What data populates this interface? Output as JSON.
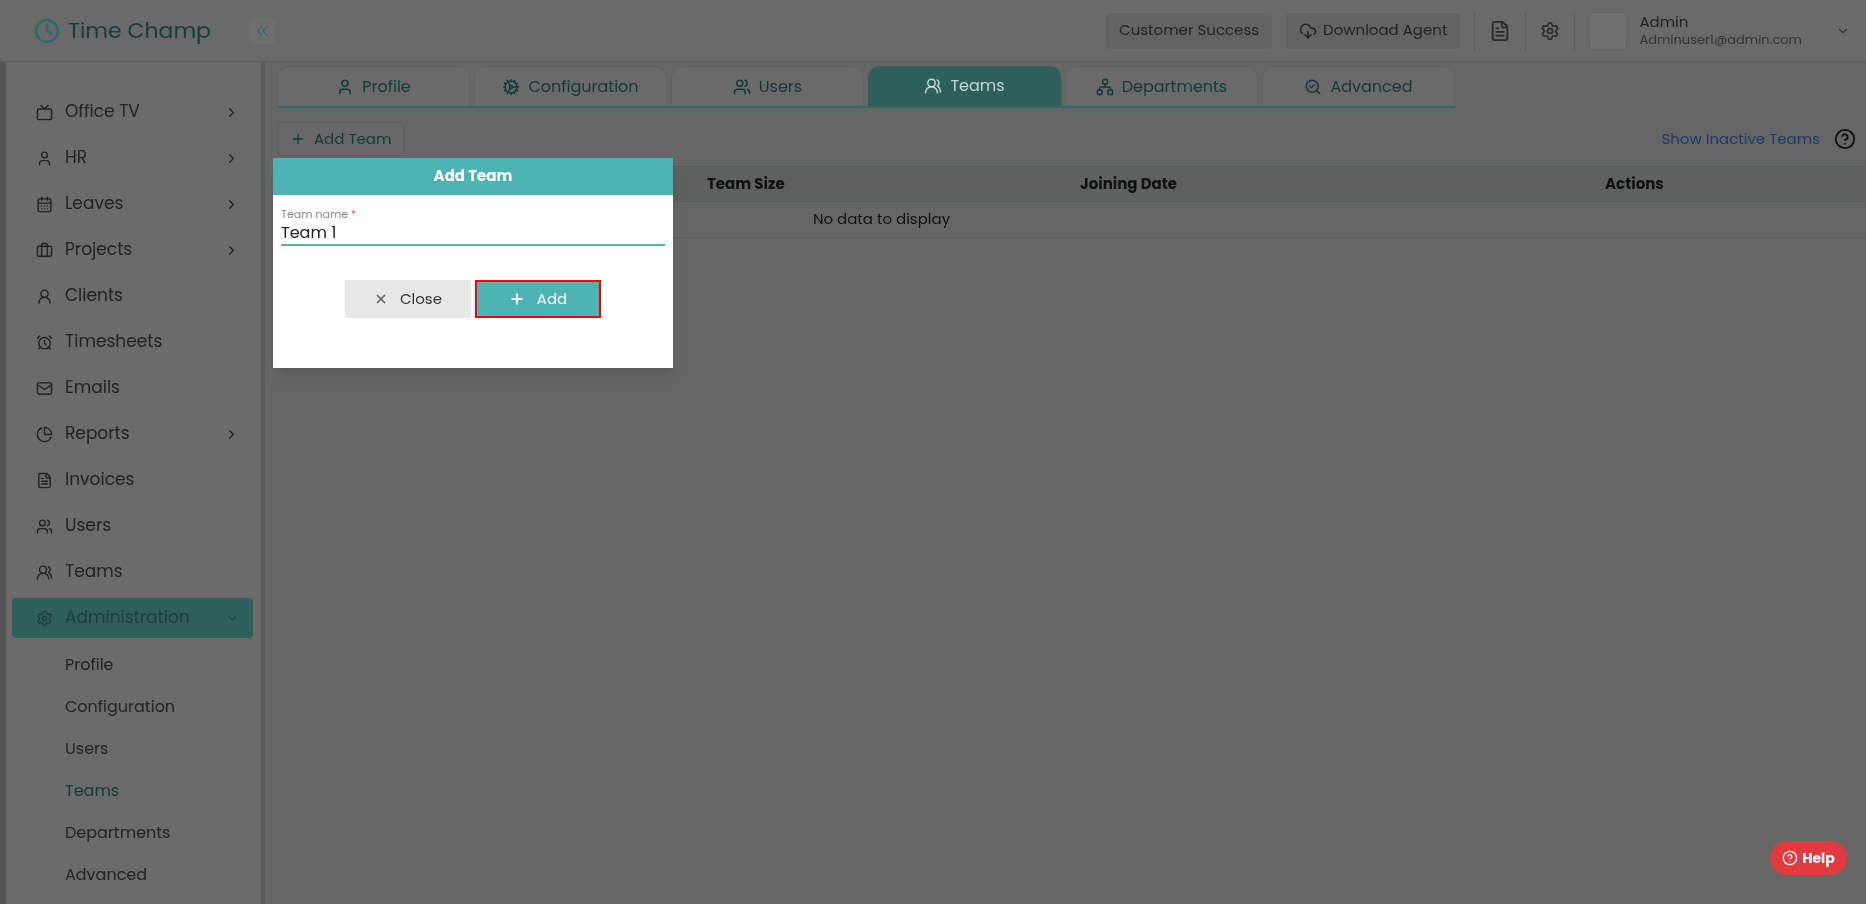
{
  "brand": {
    "name": "Time Champ"
  },
  "topbar": {
    "buttons": [
      "Customer Success",
      "Download Agent"
    ],
    "user": {
      "name": "Admin",
      "email": "Adminuser1@admin.com"
    }
  },
  "sidebar": {
    "items": [
      {
        "label": "Office TV",
        "submenu": true,
        "expanded": false,
        "selected": false
      },
      {
        "label": "HR",
        "submenu": true,
        "expanded": false,
        "selected": false
      },
      {
        "label": "Leaves",
        "submenu": true,
        "expanded": false,
        "selected": false
      },
      {
        "label": "Projects",
        "submenu": true,
        "expanded": false,
        "selected": false
      },
      {
        "label": "Clients",
        "submenu": false,
        "expanded": false,
        "selected": false
      },
      {
        "label": "Timesheets",
        "submenu": false,
        "expanded": false,
        "selected": false
      },
      {
        "label": "Emails",
        "submenu": false,
        "expanded": false,
        "selected": false
      },
      {
        "label": "Reports",
        "submenu": true,
        "expanded": false,
        "selected": false
      },
      {
        "label": "Invoices",
        "submenu": false,
        "expanded": false,
        "selected": false
      },
      {
        "label": "Users",
        "submenu": false,
        "expanded": false,
        "selected": false
      },
      {
        "label": "Teams",
        "submenu": false,
        "expanded": false,
        "selected": false
      },
      {
        "label": "Administration",
        "submenu": true,
        "expanded": true,
        "selected": true,
        "children": [
          {
            "label": "Profile",
            "selected": false
          },
          {
            "label": "Configuration",
            "selected": false
          },
          {
            "label": "Users",
            "selected": false
          },
          {
            "label": "Teams",
            "selected": true
          },
          {
            "label": "Departments",
            "selected": false
          },
          {
            "label": "Advanced",
            "selected": false
          }
        ]
      }
    ]
  },
  "tabs": [
    {
      "label": "Profile",
      "selected": false
    },
    {
      "label": "Configuration",
      "selected": false
    },
    {
      "label": "Users",
      "selected": false
    },
    {
      "label": "Teams",
      "selected": true
    },
    {
      "label": "Departments",
      "selected": false
    },
    {
      "label": "Advanced",
      "selected": false
    }
  ],
  "toolbar": {
    "add_button": "Add Team",
    "inactive_link": "Show Inactive Teams"
  },
  "table": {
    "columns": [
      "Team Size",
      "Joining Date",
      "Actions"
    ],
    "empty_message": "No data to display"
  },
  "dialog": {
    "title": "Add Team",
    "field": {
      "label": "Team name",
      "required_mark": "*",
      "value": "Team 1"
    },
    "buttons": [
      {
        "label": "Close",
        "kind": "secondary",
        "highlighted": false
      },
      {
        "label": "Add",
        "kind": "primary",
        "highlighted": true
      }
    ]
  },
  "help_button": "Help"
}
